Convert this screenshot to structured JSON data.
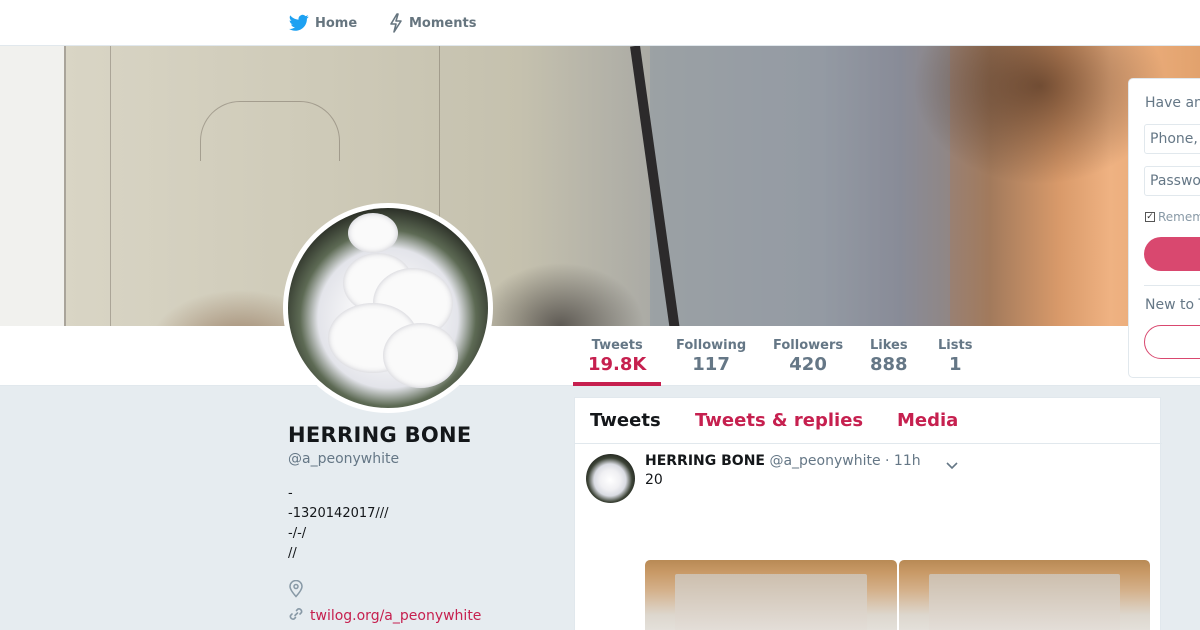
{
  "nav": {
    "home_label": "Home",
    "moments_label": "Moments",
    "home_icon": "twitter-bird-icon",
    "moments_icon": "lightning-icon"
  },
  "stats": [
    {
      "label": "Tweets",
      "value": "19.8K"
    },
    {
      "label": "Following",
      "value": "117"
    },
    {
      "label": "Followers",
      "value": "420"
    },
    {
      "label": "Likes",
      "value": "888"
    },
    {
      "label": "Lists",
      "value": "1"
    }
  ],
  "profile": {
    "name": "HERRING BONE",
    "handle": "@a_peonywhite",
    "bio": [
      "-",
      "-1320142017///",
      "-/-/",
      "//"
    ],
    "location_icon": "location-pin-icon",
    "link_icon": "link-icon",
    "link": "twilog.org/a_peonywhite"
  },
  "timeline": {
    "tabs": [
      "Tweets",
      "Tweets & replies",
      "Media"
    ],
    "tweet": {
      "name": "HERRING BONE",
      "handle": "@a_peonywhite",
      "time": "· 11h",
      "text": "20"
    }
  },
  "login": {
    "heading": "Have an",
    "phone_placeholder": "Phone,",
    "password_placeholder": "Passwo",
    "remember": "Remem",
    "new_to": "New to T"
  },
  "colors": {
    "accent": "#c6204f",
    "muted": "#657786",
    "background": "#e6ecf0"
  }
}
